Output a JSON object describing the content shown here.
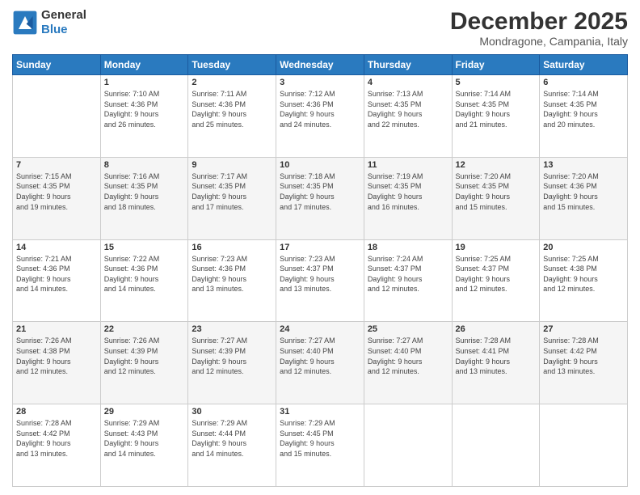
{
  "header": {
    "logo_line1": "General",
    "logo_line2": "Blue",
    "month": "December 2025",
    "location": "Mondragone, Campania, Italy"
  },
  "weekdays": [
    "Sunday",
    "Monday",
    "Tuesday",
    "Wednesday",
    "Thursday",
    "Friday",
    "Saturday"
  ],
  "weeks": [
    [
      {
        "day": "",
        "text": ""
      },
      {
        "day": "1",
        "text": "Sunrise: 7:10 AM\nSunset: 4:36 PM\nDaylight: 9 hours\nand 26 minutes."
      },
      {
        "day": "2",
        "text": "Sunrise: 7:11 AM\nSunset: 4:36 PM\nDaylight: 9 hours\nand 25 minutes."
      },
      {
        "day": "3",
        "text": "Sunrise: 7:12 AM\nSunset: 4:36 PM\nDaylight: 9 hours\nand 24 minutes."
      },
      {
        "day": "4",
        "text": "Sunrise: 7:13 AM\nSunset: 4:35 PM\nDaylight: 9 hours\nand 22 minutes."
      },
      {
        "day": "5",
        "text": "Sunrise: 7:14 AM\nSunset: 4:35 PM\nDaylight: 9 hours\nand 21 minutes."
      },
      {
        "day": "6",
        "text": "Sunrise: 7:14 AM\nSunset: 4:35 PM\nDaylight: 9 hours\nand 20 minutes."
      }
    ],
    [
      {
        "day": "7",
        "text": "Sunrise: 7:15 AM\nSunset: 4:35 PM\nDaylight: 9 hours\nand 19 minutes."
      },
      {
        "day": "8",
        "text": "Sunrise: 7:16 AM\nSunset: 4:35 PM\nDaylight: 9 hours\nand 18 minutes."
      },
      {
        "day": "9",
        "text": "Sunrise: 7:17 AM\nSunset: 4:35 PM\nDaylight: 9 hours\nand 17 minutes."
      },
      {
        "day": "10",
        "text": "Sunrise: 7:18 AM\nSunset: 4:35 PM\nDaylight: 9 hours\nand 17 minutes."
      },
      {
        "day": "11",
        "text": "Sunrise: 7:19 AM\nSunset: 4:35 PM\nDaylight: 9 hours\nand 16 minutes."
      },
      {
        "day": "12",
        "text": "Sunrise: 7:20 AM\nSunset: 4:35 PM\nDaylight: 9 hours\nand 15 minutes."
      },
      {
        "day": "13",
        "text": "Sunrise: 7:20 AM\nSunset: 4:36 PM\nDaylight: 9 hours\nand 15 minutes."
      }
    ],
    [
      {
        "day": "14",
        "text": "Sunrise: 7:21 AM\nSunset: 4:36 PM\nDaylight: 9 hours\nand 14 minutes."
      },
      {
        "day": "15",
        "text": "Sunrise: 7:22 AM\nSunset: 4:36 PM\nDaylight: 9 hours\nand 14 minutes."
      },
      {
        "day": "16",
        "text": "Sunrise: 7:23 AM\nSunset: 4:36 PM\nDaylight: 9 hours\nand 13 minutes."
      },
      {
        "day": "17",
        "text": "Sunrise: 7:23 AM\nSunset: 4:37 PM\nDaylight: 9 hours\nand 13 minutes."
      },
      {
        "day": "18",
        "text": "Sunrise: 7:24 AM\nSunset: 4:37 PM\nDaylight: 9 hours\nand 12 minutes."
      },
      {
        "day": "19",
        "text": "Sunrise: 7:25 AM\nSunset: 4:37 PM\nDaylight: 9 hours\nand 12 minutes."
      },
      {
        "day": "20",
        "text": "Sunrise: 7:25 AM\nSunset: 4:38 PM\nDaylight: 9 hours\nand 12 minutes."
      }
    ],
    [
      {
        "day": "21",
        "text": "Sunrise: 7:26 AM\nSunset: 4:38 PM\nDaylight: 9 hours\nand 12 minutes."
      },
      {
        "day": "22",
        "text": "Sunrise: 7:26 AM\nSunset: 4:39 PM\nDaylight: 9 hours\nand 12 minutes."
      },
      {
        "day": "23",
        "text": "Sunrise: 7:27 AM\nSunset: 4:39 PM\nDaylight: 9 hours\nand 12 minutes."
      },
      {
        "day": "24",
        "text": "Sunrise: 7:27 AM\nSunset: 4:40 PM\nDaylight: 9 hours\nand 12 minutes."
      },
      {
        "day": "25",
        "text": "Sunrise: 7:27 AM\nSunset: 4:40 PM\nDaylight: 9 hours\nand 12 minutes."
      },
      {
        "day": "26",
        "text": "Sunrise: 7:28 AM\nSunset: 4:41 PM\nDaylight: 9 hours\nand 13 minutes."
      },
      {
        "day": "27",
        "text": "Sunrise: 7:28 AM\nSunset: 4:42 PM\nDaylight: 9 hours\nand 13 minutes."
      }
    ],
    [
      {
        "day": "28",
        "text": "Sunrise: 7:28 AM\nSunset: 4:42 PM\nDaylight: 9 hours\nand 13 minutes."
      },
      {
        "day": "29",
        "text": "Sunrise: 7:29 AM\nSunset: 4:43 PM\nDaylight: 9 hours\nand 14 minutes."
      },
      {
        "day": "30",
        "text": "Sunrise: 7:29 AM\nSunset: 4:44 PM\nDaylight: 9 hours\nand 14 minutes."
      },
      {
        "day": "31",
        "text": "Sunrise: 7:29 AM\nSunset: 4:45 PM\nDaylight: 9 hours\nand 15 minutes."
      },
      {
        "day": "",
        "text": ""
      },
      {
        "day": "",
        "text": ""
      },
      {
        "day": "",
        "text": ""
      }
    ]
  ]
}
